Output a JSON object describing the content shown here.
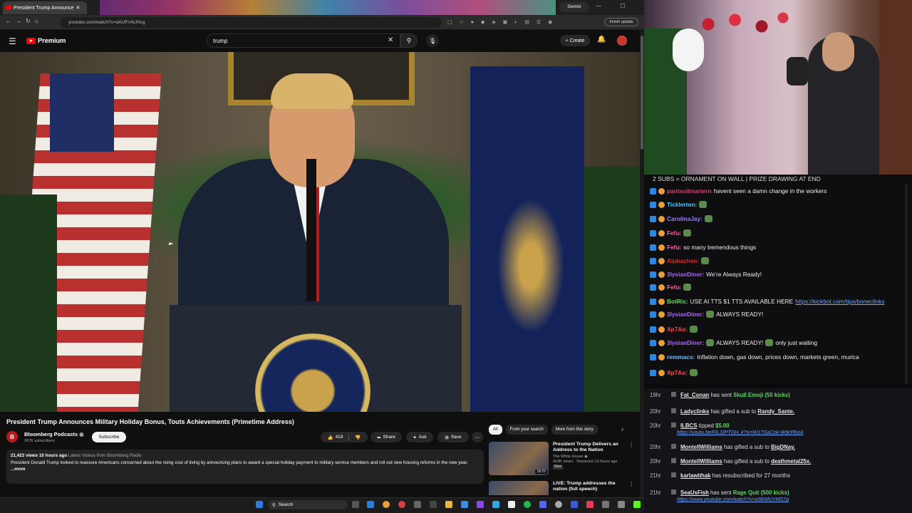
{
  "browser": {
    "tab_title": "President Trump Announce",
    "gemini_label": "Gemini",
    "url": "youtube.com/watch?v=dAUFn4LINcg",
    "finish_update": "Finish update",
    "window_controls": "— ☐ ✕"
  },
  "youtube": {
    "logo_text": "Premium",
    "search_value": "trump",
    "create_label": "Create"
  },
  "video": {
    "title": "President Trump Announces Military Holiday Bonus, Touts Achievements (Primetime Address)",
    "channel": "Bloomberg Podcasts",
    "channel_initial": "B",
    "subscribers": "397K subscribers",
    "subscribe_label": "Subscribe",
    "likes": "419",
    "share_label": "Share",
    "ask_label": "Ask",
    "save_label": "Save",
    "views_time": "21,423 views  10 hours ago",
    "desc_link": "Latest Videos from Bloomberg Radio",
    "description": "President Donald Trump looked to reassure Americans concerned about the rising cost of living by announcing plans to award a special holiday payment to military service members and roll out new housing reforms in the new year.",
    "more_label": "...more"
  },
  "chips": [
    "All",
    "From your search",
    "More from this story"
  ],
  "recommendations": [
    {
      "title": "President Trump Delivers an Address to the Nation",
      "channel": "The White House",
      "meta": "414K views · Streamed 13 hours ago",
      "badge": "New",
      "duration": "18:22"
    },
    {
      "title": "LIVE: Trump addresses the nation (full speech)",
      "channel": "",
      "meta": "",
      "badge": "",
      "duration": ""
    }
  ],
  "taskbar": {
    "search_label": "Search"
  },
  "stream": {
    "goal_text": "2 SUBS = ORNAMENT ON WALL | PRIZE DRAWING AT END"
  },
  "chat": [
    {
      "user": "pantsoilmartern",
      "text": "havent seen a damn change in the workers",
      "color": "#d04070"
    },
    {
      "user": "Ticklerton:",
      "text": "",
      "color": "#40c8ff"
    },
    {
      "user": "CarolinaJay:",
      "text": "",
      "color": "#9a7cff"
    },
    {
      "user": "Fefu:",
      "text": "",
      "color": "#ff5aa8"
    },
    {
      "user": "Fefu:",
      "text": "so many tremendous things",
      "color": "#ff5aa8"
    },
    {
      "user": "Alphachen:",
      "text": "",
      "color": "#e02828"
    },
    {
      "user": "3lysianDiner:",
      "text": "We're Always Ready!",
      "color": "#b060ff"
    },
    {
      "user": "Fefu:",
      "text": "",
      "color": "#ff5aa8"
    },
    {
      "user": "BotRix:",
      "text": "USE AI TTS $1 TTS AVAILABLE HERE",
      "link": "https://kickbot.com/tips/boneclinks",
      "color": "#58e058"
    },
    {
      "user": "3lysianDiner:",
      "text": "ALWAYS READY!",
      "color": "#b060ff"
    },
    {
      "user": "Xp7Ao:",
      "text": "",
      "color": "#ff4848"
    },
    {
      "user": "3lysianDiner:",
      "text": "ALWAYS READY!",
      "text2": "only just waiting",
      "color": "#b060ff"
    },
    {
      "user": "remmacs:",
      "text": "Inflation down, gas down, prices down, markets green, murica",
      "color": "#60c0ff"
    },
    {
      "user": "Xp7Ao:",
      "text": "",
      "color": "#ff4848"
    }
  ],
  "events": [
    {
      "time": "19hr",
      "name": "Fat_Conan",
      "text": "has sent",
      "gift": "Skull Emoji (50 kicks)"
    },
    {
      "time": "20hr",
      "name": "Ladyclinks",
      "text": "has gifted a sub to",
      "target": "Randy_Sante."
    },
    {
      "time": "20hr",
      "name": "ILBCS",
      "text": "tipped",
      "gift": "$5.00",
      "link": "https://youtu.be/FiLJ2PTOH_k?si=W1TGaCok-W9cPEeA"
    },
    {
      "time": "20hr",
      "name": "MontellWilliams",
      "text": "has gifted a sub to",
      "target": "BigDNay."
    },
    {
      "time": "20hr",
      "name": "MontellWilliams",
      "text": "has gifted a sub to",
      "target": "deathmetal25x."
    },
    {
      "time": "21hr",
      "name": "karlawithak",
      "text": "has resubscribed for 27 months"
    },
    {
      "time": "21hr",
      "name": "SeaUsFish",
      "text": "has sent",
      "gift": "Rage Quit (500 kicks)",
      "link": "https://www.youtube.com/watch?v=zi9EMUYMS7g"
    }
  ]
}
